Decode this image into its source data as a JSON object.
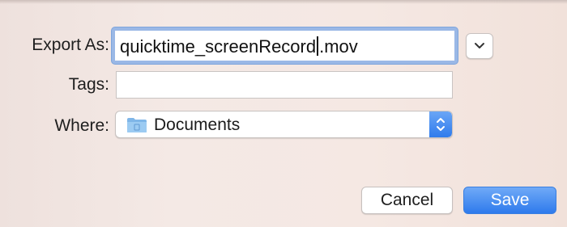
{
  "dialog": {
    "export_as": {
      "label": "Export As:",
      "value_before_caret": "quicktime_screenRecord",
      "value_after_caret": ".mov"
    },
    "tags": {
      "label": "Tags:",
      "value": ""
    },
    "where": {
      "label": "Where:",
      "value": "Documents",
      "icon": "folder-icon"
    },
    "buttons": {
      "cancel": "Cancel",
      "save": "Save"
    },
    "expand_icon": "chevron-down-icon",
    "stepper_icon": "up-down-arrows-icon"
  },
  "colors": {
    "accent": "#3b82f0",
    "focus_ring": "#9ab8e6",
    "background": "#f4e9e5"
  }
}
